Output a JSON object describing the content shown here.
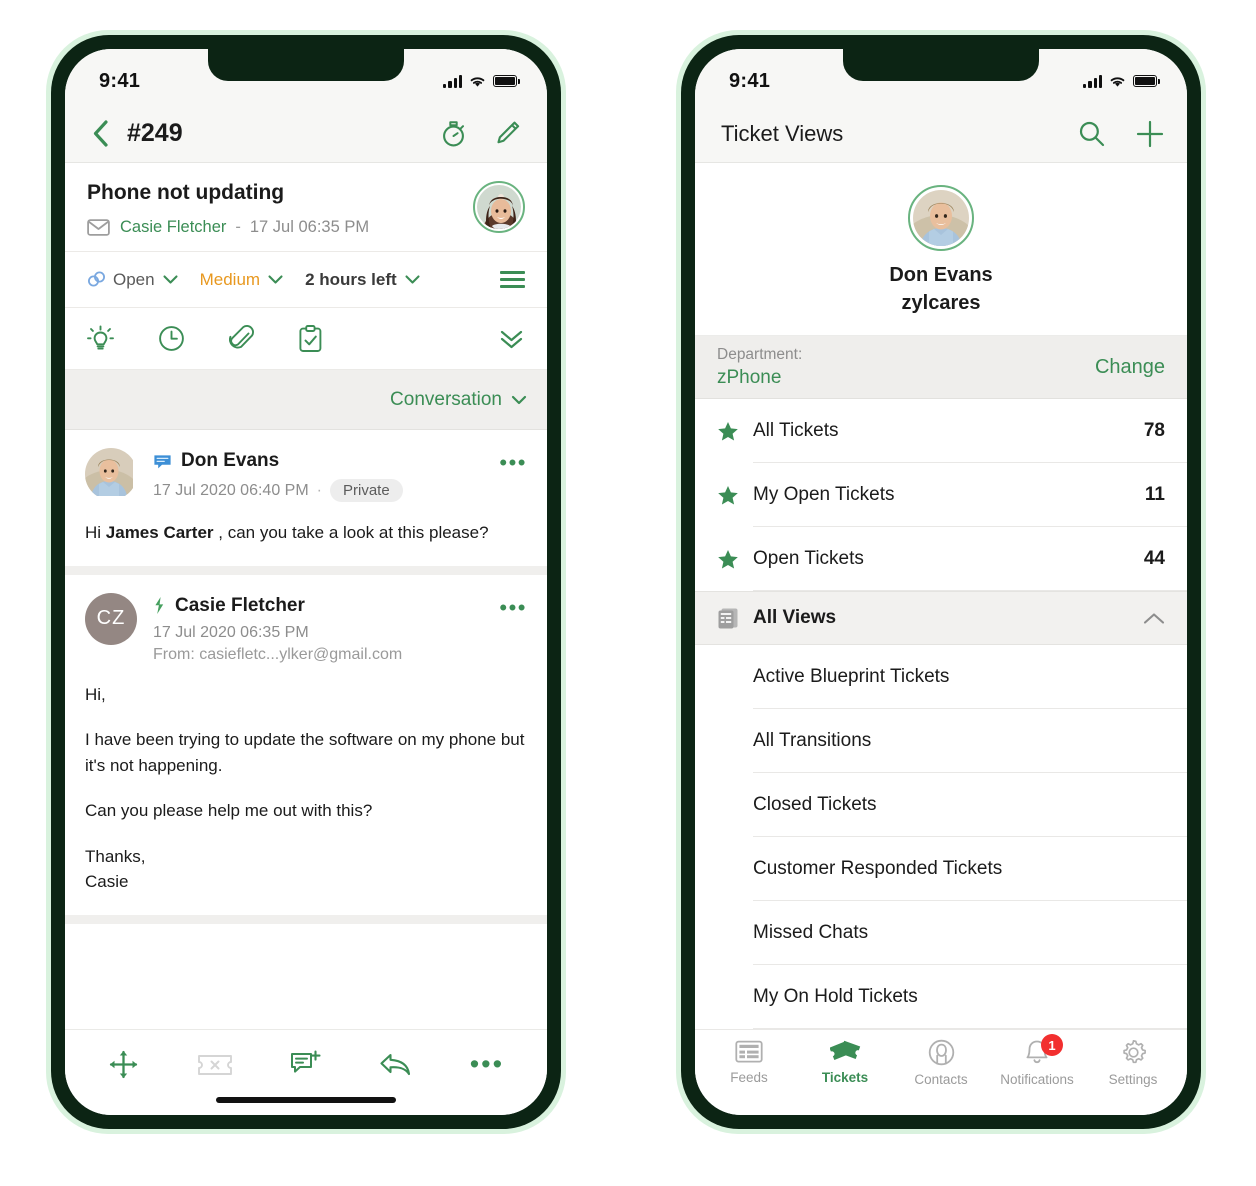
{
  "left_phone": {
    "status_bar": {
      "time": "9:41"
    },
    "nav": {
      "back_icon": "chevron-left-icon",
      "title": "#249",
      "timer_icon": "stopwatch-icon",
      "edit_icon": "pencil-icon"
    },
    "ticket": {
      "subject": "Phone not updating",
      "channel_icon": "email-icon",
      "contact_name": "Casie Fletcher",
      "separator": "-",
      "received": "17 Jul 06:35 PM",
      "avatar_name": "contact-avatar"
    },
    "properties": {
      "status_icon": "status-circles-icon",
      "status": "Open",
      "priority": "Medium",
      "sla": "2 hours left",
      "menu_icon": "hamburger-menu-icon",
      "chevron": "chevron-down-icon"
    },
    "toolbar": [
      {
        "icon": "lightbulb-icon",
        "name": "suggestions"
      },
      {
        "icon": "clock-icon",
        "name": "time-entry"
      },
      {
        "icon": "paperclip-icon",
        "name": "attachments"
      },
      {
        "icon": "clipboard-check-icon",
        "name": "tasks"
      }
    ],
    "toolbar_expand_icon": "chevrons-down-icon",
    "filter_bar": {
      "label": "Conversation",
      "chevron_icon": "chevron-down-icon"
    },
    "messages": [
      {
        "type": "comment",
        "type_icon": "comment-bubble-icon",
        "author": "Don Evans",
        "timestamp": "17 Jul 2020 06:40 PM",
        "visibility": "Private",
        "avatar": "photo",
        "more_icon": "more-horizontal-icon",
        "body_prefix": "Hi ",
        "body_mention": "James Carter",
        "body_suffix": " , can you take a look at this please?"
      },
      {
        "type": "email",
        "type_icon": "thread-icon",
        "author": "Casie Fletcher",
        "timestamp": "17 Jul 2020 06:35 PM",
        "from": "From: casiefletc...ylker@gmail.com",
        "avatar_initials": "CZ",
        "more_icon": "more-horizontal-icon",
        "paragraphs": [
          "Hi,",
          "I have been trying to update the software on my phone but it's not happening.",
          "Can you please help me out with this?",
          "Thanks,\nCasie"
        ]
      }
    ],
    "bottom_actions": [
      {
        "icon": "move-arrows-icon",
        "name": "move-ticket",
        "enabled": true
      },
      {
        "icon": "ticket-close-icon",
        "name": "close-ticket",
        "enabled": false
      },
      {
        "icon": "add-comment-icon",
        "name": "add-comment",
        "enabled": true
      },
      {
        "icon": "reply-icon",
        "name": "reply",
        "enabled": true
      },
      {
        "icon": "more-horizontal-icon",
        "name": "more-actions",
        "enabled": true
      }
    ]
  },
  "right_phone": {
    "status_bar": {
      "time": "9:41"
    },
    "nav": {
      "title": "Ticket Views",
      "search_icon": "search-icon",
      "add_icon": "plus-icon"
    },
    "profile": {
      "avatar_name": "agent-avatar",
      "name": "Don Evans",
      "org": "zylcares"
    },
    "department": {
      "label": "Department:",
      "value": "zPhone",
      "change_label": "Change"
    },
    "starred_views": [
      {
        "icon": "star-icon",
        "label": "All Tickets",
        "count": "78"
      },
      {
        "icon": "star-icon",
        "label": "My Open Tickets",
        "count": "11"
      },
      {
        "icon": "star-icon",
        "label": "Open Tickets",
        "count": "44"
      }
    ],
    "all_views_section": {
      "icon": "list-view-icon",
      "label": "All Views",
      "collapse_icon": "chevron-up-icon",
      "items": [
        {
          "label": "Active Blueprint Tickets"
        },
        {
          "label": "All Transitions"
        },
        {
          "label": "Closed Tickets"
        },
        {
          "label": "Customer Responded Tickets"
        },
        {
          "label": "Missed Chats"
        },
        {
          "label": "My On Hold Tickets"
        }
      ]
    },
    "tabs": [
      {
        "icon": "newspaper-icon",
        "label": "Feeds",
        "active": false,
        "badge": ""
      },
      {
        "icon": "tickets-icon",
        "label": "Tickets",
        "active": true,
        "badge": ""
      },
      {
        "icon": "contact-icon",
        "label": "Contacts",
        "active": false,
        "badge": ""
      },
      {
        "icon": "bell-icon",
        "label": "Notifications",
        "active": false,
        "badge": "1"
      },
      {
        "icon": "gear-icon",
        "label": "Settings",
        "active": false,
        "badge": ""
      }
    ]
  },
  "colors": {
    "accent_green": "#3b8d55",
    "bezel": "#0c2414",
    "outer_ring": "#d9f2de",
    "priority_orange": "#e8981f",
    "badge_red": "#f22f2f"
  }
}
